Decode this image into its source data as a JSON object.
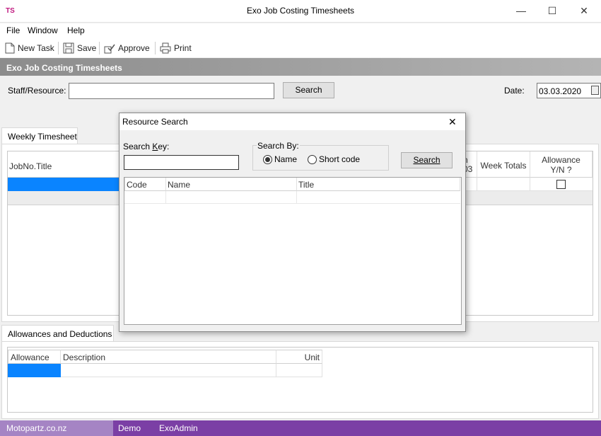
{
  "window": {
    "app_icon": "TS",
    "title": "Exo Job Costing Timesheets",
    "minimize_icon": "—",
    "maximize_icon": "☐",
    "close_icon": "✕"
  },
  "menu": {
    "file": "File",
    "window": "Window",
    "help": "Help"
  },
  "toolbar": {
    "new_task": "New Task",
    "save": "Save",
    "approve": "Approve",
    "print": "Print"
  },
  "section_title": "Exo Job Costing Timesheets",
  "staff": {
    "label": "Staff/Resource:",
    "value": "",
    "search_label": "Search"
  },
  "date": {
    "label": "Date:",
    "value": "03.03.2020"
  },
  "weekly_tab": "Weekly Timesheet",
  "timesheet_grid": {
    "col_job": "JobNo.Title",
    "col_partial_top": "n",
    "col_partial_bottom": "03",
    "col_week_totals": "Week Totals",
    "col_allowance": "Allowance Y/N ?"
  },
  "allowances_tab": "Allowances and Deductions",
  "allowances_grid": {
    "col_id": "Allowance ID",
    "col_desc": "Description",
    "col_unit": "Unit"
  },
  "status": {
    "company": "Motopartz.co.nz",
    "db": "Demo",
    "user": "ExoAdmin"
  },
  "dialog": {
    "title": "Resource Search",
    "close_icon": "✕",
    "search_key_label_pre": "Search ",
    "search_key_label_ul": "K",
    "search_key_label_post": "ey:",
    "search_key_value": "",
    "search_by_label": "Search By:",
    "option_name": "Name",
    "option_short": "Short code",
    "selected_option": "Name",
    "search_btn": "Search",
    "columns": [
      "Code",
      "Name",
      "Title"
    ]
  },
  "colors": {
    "status_bar": "#7b3fa5",
    "selection": "#0a84ff",
    "app_icon": "#c0187f"
  }
}
